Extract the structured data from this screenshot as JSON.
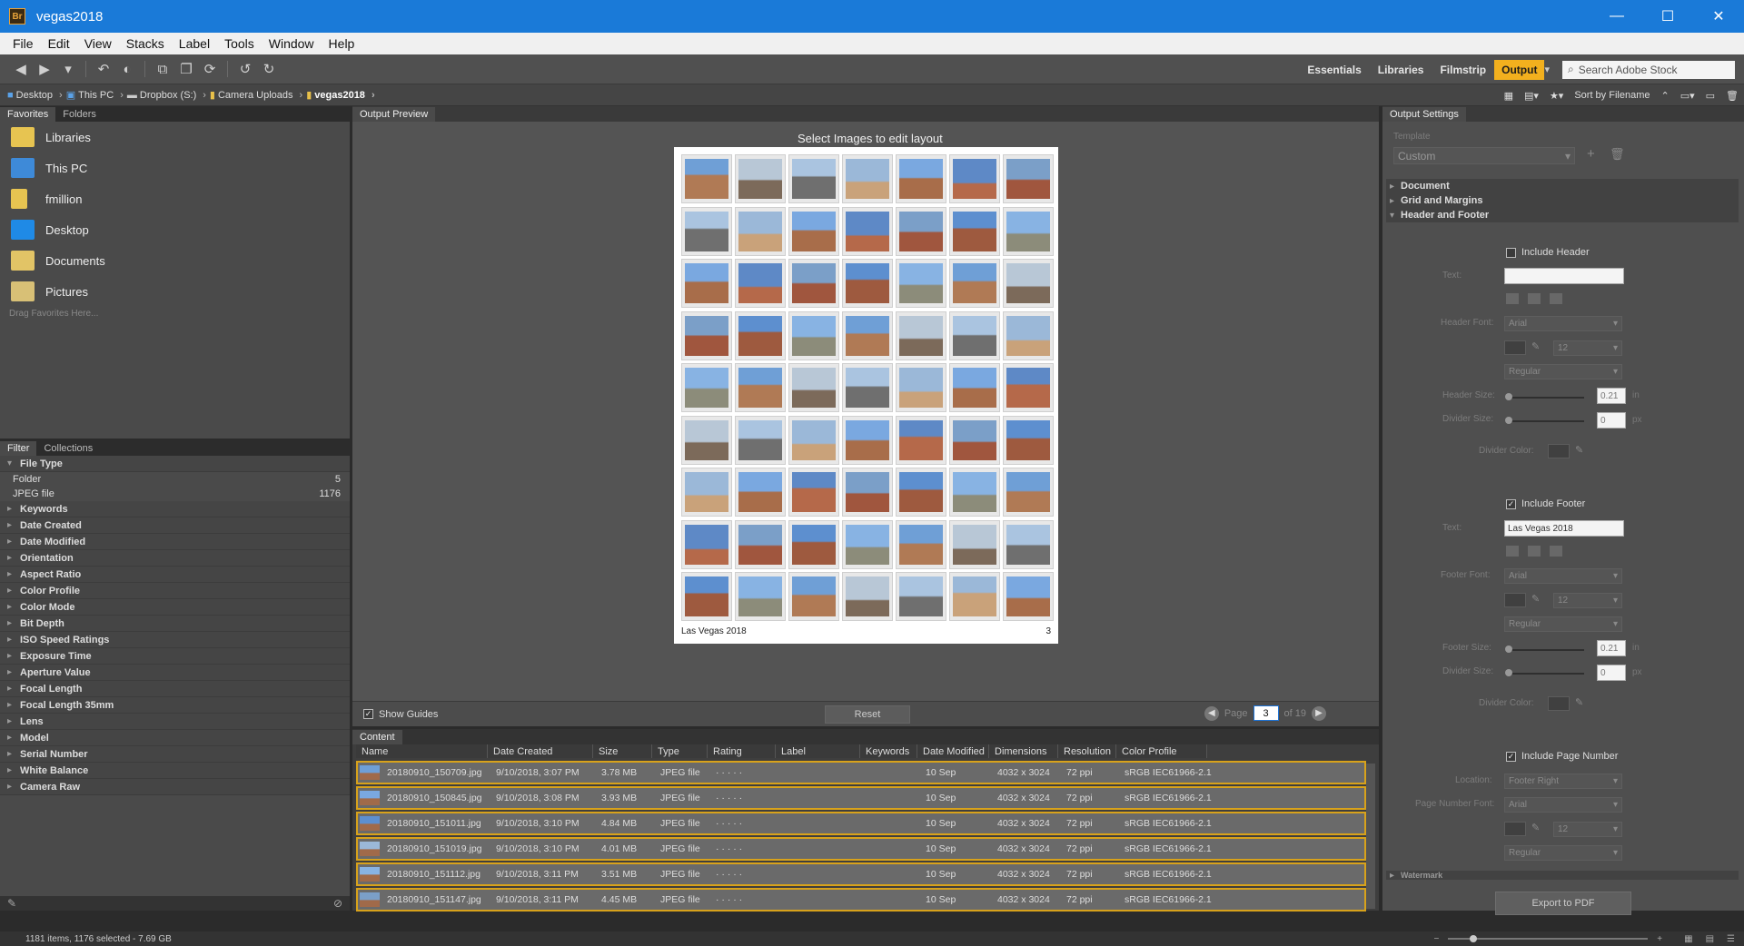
{
  "window": {
    "title": "vegas2018",
    "app_badge": "Br",
    "controls": [
      "—",
      "☐",
      "✕"
    ]
  },
  "menu": [
    "File",
    "Edit",
    "View",
    "Stacks",
    "Label",
    "Tools",
    "Window",
    "Help"
  ],
  "workspaces": {
    "items": [
      "Essentials",
      "Libraries",
      "Filmstrip",
      "Output"
    ],
    "active": "Output",
    "search_placeholder": "Search Adobe Stock"
  },
  "breadcrumb": [
    "Desktop",
    "This PC",
    "Dropbox (S:)",
    "Camera Uploads",
    "vegas2018"
  ],
  "sort_label": "Sort by Filename",
  "favorites": {
    "tabs": [
      "Favorites",
      "Folders"
    ],
    "items": [
      "Libraries",
      "This PC",
      "fmillion",
      "Desktop",
      "Documents",
      "Pictures"
    ],
    "hint": "Drag Favorites Here..."
  },
  "filter": {
    "tabs": [
      "Filter",
      "Collections"
    ],
    "file_type": {
      "label": "File Type",
      "entries": [
        {
          "name": "Folder",
          "count": "5"
        },
        {
          "name": "JPEG file",
          "count": "1176"
        }
      ]
    },
    "categories": [
      "Keywords",
      "Date Created",
      "Date Modified",
      "Orientation",
      "Aspect Ratio",
      "Color Profile",
      "Color Mode",
      "Bit Depth",
      "ISO Speed Ratings",
      "Exposure Time",
      "Aperture Value",
      "Focal Length",
      "Focal Length 35mm",
      "Lens",
      "Model",
      "Serial Number",
      "White Balance",
      "Camera Raw"
    ]
  },
  "preview": {
    "tab": "Output Preview",
    "instruction": "Select Images to edit layout",
    "footer_text": "Las Vegas 2018",
    "page_number": "3",
    "show_guides": "Show Guides",
    "reset": "Reset",
    "page_label": "Page",
    "page_value": "3",
    "page_of": "of 19"
  },
  "content": {
    "tab": "Content",
    "columns": [
      "Name",
      "Date Created",
      "Size",
      "Type",
      "Rating",
      "Label",
      "Keywords",
      "Date Modified",
      "Dimensions",
      "Resolution",
      "Color Profile"
    ],
    "rows": [
      {
        "name": "20180910_150709.jpg",
        "created": "9/10/2018, 3:07 PM",
        "size": "3.78 MB",
        "type": "JPEG file",
        "rating": "· · · · ·",
        "label": "",
        "keywords": "",
        "modified": "10 Sep",
        "dimensions": "4032 x 3024",
        "resolution": "72 ppi",
        "profile": "sRGB IEC61966-2.1"
      },
      {
        "name": "20180910_150845.jpg",
        "created": "9/10/2018, 3:08 PM",
        "size": "3.93 MB",
        "type": "JPEG file",
        "rating": "· · · · ·",
        "label": "",
        "keywords": "",
        "modified": "10 Sep",
        "dimensions": "4032 x 3024",
        "resolution": "72 ppi",
        "profile": "sRGB IEC61966-2.1"
      },
      {
        "name": "20180910_151011.jpg",
        "created": "9/10/2018, 3:10 PM",
        "size": "4.84 MB",
        "type": "JPEG file",
        "rating": "· · · · ·",
        "label": "",
        "keywords": "",
        "modified": "10 Sep",
        "dimensions": "4032 x 3024",
        "resolution": "72 ppi",
        "profile": "sRGB IEC61966-2.1"
      },
      {
        "name": "20180910_151019.jpg",
        "created": "9/10/2018, 3:10 PM",
        "size": "4.01 MB",
        "type": "JPEG file",
        "rating": "· · · · ·",
        "label": "",
        "keywords": "",
        "modified": "10 Sep",
        "dimensions": "4032 x 3024",
        "resolution": "72 ppi",
        "profile": "sRGB IEC61966-2.1"
      },
      {
        "name": "20180910_151112.jpg",
        "created": "9/10/2018, 3:11 PM",
        "size": "3.51 MB",
        "type": "JPEG file",
        "rating": "· · · · ·",
        "label": "",
        "keywords": "",
        "modified": "10 Sep",
        "dimensions": "4032 x 3024",
        "resolution": "72 ppi",
        "profile": "sRGB IEC61966-2.1"
      },
      {
        "name": "20180910_151147.jpg",
        "created": "9/10/2018, 3:11 PM",
        "size": "4.45 MB",
        "type": "JPEG file",
        "rating": "· · · · ·",
        "label": "",
        "keywords": "",
        "modified": "10 Sep",
        "dimensions": "4032 x 3024",
        "resolution": "72 ppi",
        "profile": "sRGB IEC61966-2.1"
      }
    ]
  },
  "settings": {
    "tab": "Output Settings",
    "template_label": "Template",
    "template_value": "Custom",
    "sections": [
      "Document",
      "Grid and Margins",
      "Header and Footer"
    ],
    "include_header": "Include Header",
    "text_label": "Text:",
    "header_text": "",
    "header_font_label": "Header Font:",
    "footer_font_label": "Footer Font:",
    "font_value": "Arial",
    "font_size_value": "12",
    "style_value": "Regular",
    "header_size_label": "Header Size:",
    "footer_size_label": "Footer Size:",
    "divider_size_label": "Divider Size:",
    "divider_color_label": "Divider Color:",
    "size_value": "0.21",
    "divider_value": "0",
    "unit_in": "in",
    "unit_px": "px",
    "include_footer": "Include Footer",
    "footer_text": "Las Vegas 2018",
    "include_page_number": "Include Page Number",
    "location_label": "Location:",
    "location_value": "Footer Right",
    "page_number_font_label": "Page Number Font:",
    "watermark_label": "Watermark",
    "export_button": "Export to PDF"
  },
  "status": {
    "summary": "1181 items, 1176 selected - 7.69 GB"
  }
}
